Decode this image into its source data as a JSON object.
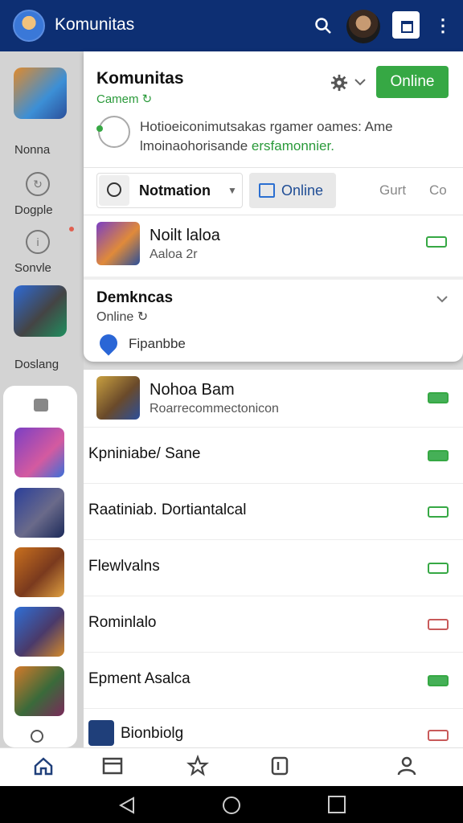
{
  "header": {
    "title": "Komunitas",
    "icons": [
      "app-avatar",
      "search-icon",
      "user-avatar",
      "window-icon",
      "more-vert-icon"
    ]
  },
  "rail": {
    "labels": [
      "Nonna",
      "Dogple",
      "Sonvle",
      "Doslang"
    ]
  },
  "panel": {
    "title": "Komunitas",
    "subtitle": "Camem ↻",
    "online_button": "Online",
    "description_a": "Hotioeiconimutsakas rgamer oames: Ame",
    "description_b": "lmoinaohorisande ",
    "description_c": "ersfamonnier.",
    "filter": {
      "dropdown_label": "Notmation",
      "segment_label": "Online",
      "text_1": "Gurt",
      "text_2": "Co"
    },
    "game_row": {
      "title": "Noilt laloa",
      "subtitle": "Aaloa 2r"
    },
    "expand": {
      "title": "Demkncas",
      "subtitle": "Online ↻",
      "link": "Fipanbbe"
    }
  },
  "list": {
    "header_row": {
      "title": "Nohoa Bam",
      "subtitle": "Roarrecommectonicon"
    },
    "items": [
      {
        "label": "Kpniniabe/ Sane",
        "state": "on"
      },
      {
        "label": "Raatiniab. Dortiantalcal",
        "state": "outline"
      },
      {
        "label": "Flewlvalns",
        "state": "outline"
      },
      {
        "label": "Rominlalo",
        "state": "off"
      },
      {
        "label": "Epment Asalca",
        "state": "on"
      },
      {
        "label": "Bionbiolg",
        "state": "off"
      }
    ]
  },
  "bottom_nav": [
    "home-icon",
    "store-icon",
    "star-icon",
    "tasks-icon",
    "profile-icon"
  ],
  "colors": {
    "topbar": "#0d2f73",
    "accent_green": "#36a844",
    "link_blue": "#1f4d95"
  }
}
